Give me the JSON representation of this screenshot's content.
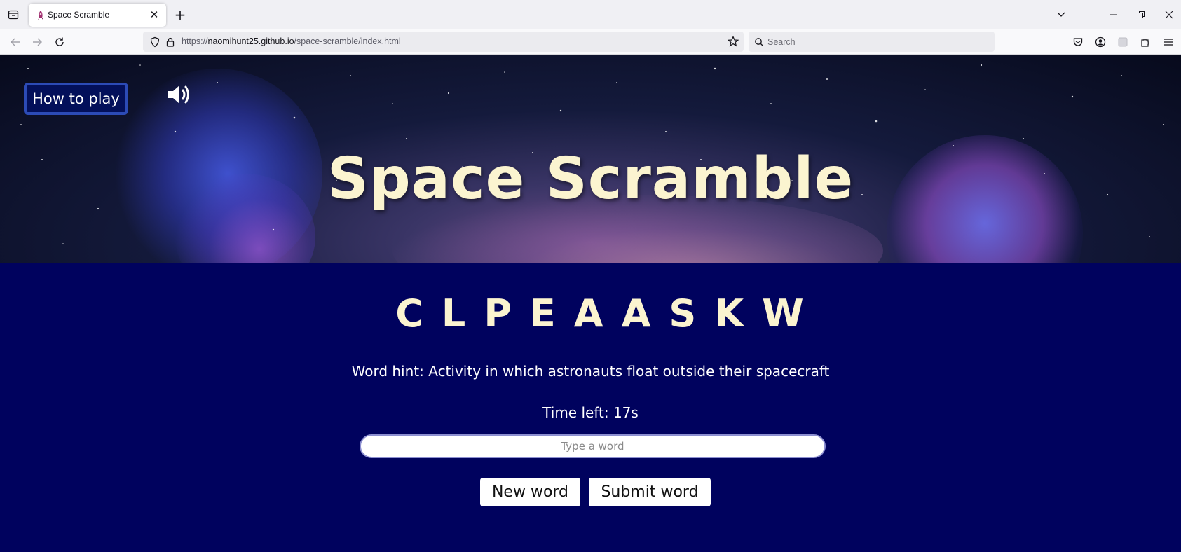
{
  "browser": {
    "tab": {
      "title": "Space Scramble"
    },
    "url": {
      "scheme": "https://",
      "host": "naomihunt25.github.io",
      "path": "/space-scramble/index.html"
    },
    "search": {
      "placeholder": "Search"
    }
  },
  "header": {
    "how_to_play_label": "How to play",
    "title": "Space Scramble"
  },
  "game": {
    "scrambled_word": "CLPEAASKW",
    "hint_label": "Word hint:",
    "hint_text": "Activity in which astronauts float outside their spacecraft",
    "timer_label": "Time left:",
    "timer_value": "17s",
    "input": {
      "placeholder": "Type a word",
      "value": ""
    },
    "new_word_label": "New word",
    "submit_word_label": "Submit word"
  },
  "colors": {
    "page_background": "#00025e",
    "title_text": "#fbf4d0",
    "how_to_play_border": "#2c4bb6",
    "how_to_play_fill": "#03105a"
  },
  "icons": {
    "sound": "speaker-volume-icon",
    "favicon": "rocket-icon"
  }
}
